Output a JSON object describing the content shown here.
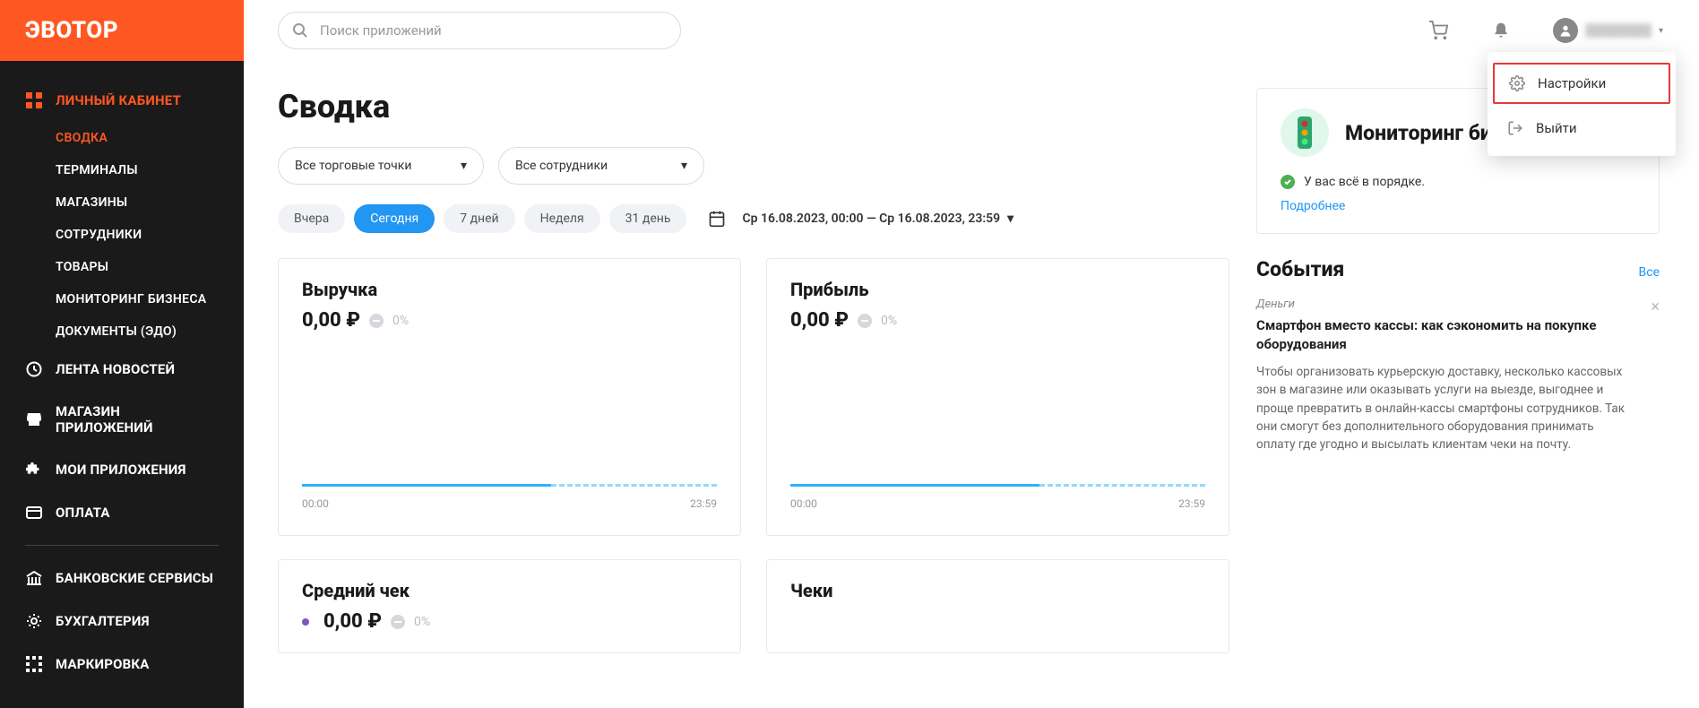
{
  "brand": "ЭВОТОР",
  "search": {
    "placeholder": "Поиск приложений"
  },
  "user": {
    "name": "████████"
  },
  "user_menu": {
    "settings": "Настройки",
    "logout": "Выйти"
  },
  "sidebar": {
    "main": "ЛИЧНЫЙ КАБИНЕТ",
    "sub": [
      {
        "label": "СВОДКА",
        "active": true
      },
      {
        "label": "ТЕРМИНАЛЫ"
      },
      {
        "label": "МАГАЗИНЫ"
      },
      {
        "label": "СОТРУДНИКИ"
      },
      {
        "label": "ТОВАРЫ"
      },
      {
        "label": "МОНИТОРИНГ БИЗНЕСА"
      },
      {
        "label": "ДОКУМЕНТЫ (ЭДО)"
      }
    ],
    "items": [
      {
        "label": "ЛЕНТА НОВОСТЕЙ"
      },
      {
        "label": "МАГАЗИН ПРИЛОЖЕНИЙ"
      },
      {
        "label": "МОИ ПРИЛОЖЕНИЯ"
      },
      {
        "label": "ОПЛАТА"
      }
    ],
    "items2": [
      {
        "label": "БАНКОВСКИЕ СЕРВИСЫ"
      },
      {
        "label": "БУХГАЛТЕРИЯ"
      },
      {
        "label": "МАРКИРОВКА"
      }
    ]
  },
  "page": {
    "title": "Сводка"
  },
  "filters": {
    "stores": "Все торговые точки",
    "staff": "Все сотрудники"
  },
  "periods": {
    "yesterday": "Вчера",
    "today": "Сегодня",
    "week": "7 дней",
    "week_named": "Неделя",
    "month": "31 день"
  },
  "date_range": "Ср 16.08.2023, 00:00 — Ср 16.08.2023, 23:59",
  "cards": {
    "revenue": {
      "title": "Выручка",
      "value": "0,00 ₽",
      "pct": "0%",
      "t0": "00:00",
      "t1": "23:59"
    },
    "profit": {
      "title": "Прибыль",
      "value": "0,00 ₽",
      "pct": "0%",
      "t0": "00:00",
      "t1": "23:59"
    },
    "avg": {
      "title": "Средний чек",
      "value": "0,00 ₽",
      "pct": "0%"
    },
    "receipts": {
      "title": "Чеки"
    }
  },
  "monitoring": {
    "title": "Мониторинг бизнеса",
    "status": "У вас всё в порядке.",
    "more": "Подробнее"
  },
  "events": {
    "title": "События",
    "all": "Все",
    "item": {
      "category": "Деньги",
      "title": "Смартфон вместо кассы: как сэкономить на покупке оборудования",
      "body": "Чтобы организовать курьерскую доставку, несколько кассовых зон в магазине или оказывать услуги на выезде, выгоднее и проще превратить в онлайн-кассы смартфоны сотрудников. Так они смогут без дополнительного оборудования принимать оплату где угодно и высылать клиентам чеки на почту."
    }
  }
}
